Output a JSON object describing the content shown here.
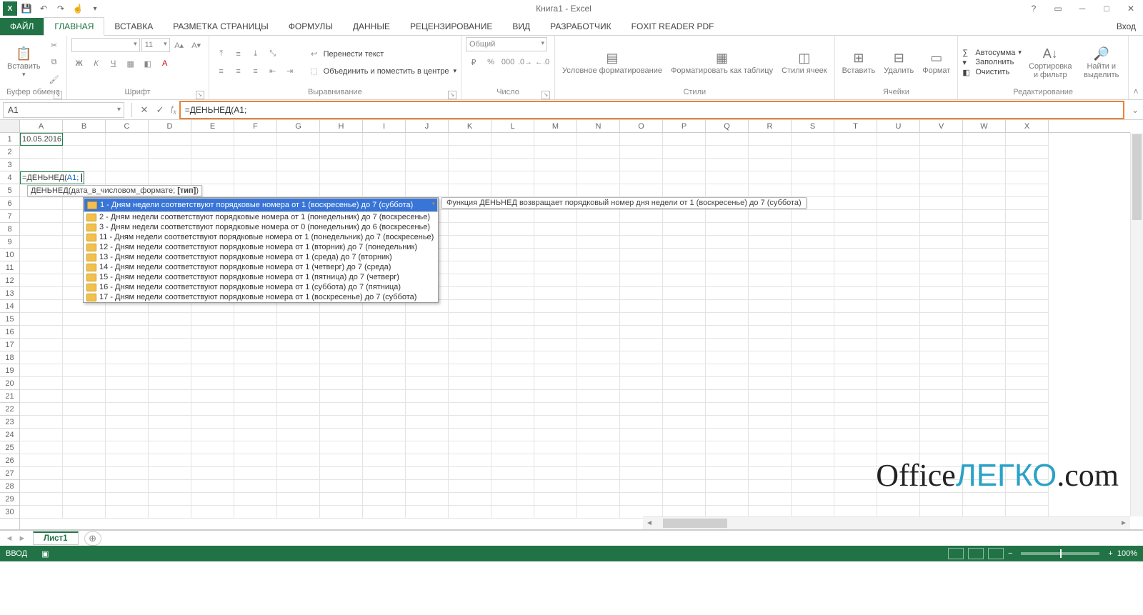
{
  "title": "Книга1 - Excel",
  "qat_icons": [
    "save",
    "undo",
    "redo",
    "touch",
    "dropdown"
  ],
  "login": "Вход",
  "help_icon": "?",
  "win": {
    "min": "─",
    "max": "□",
    "close": "✕",
    "ribmin": "▭"
  },
  "tabs": {
    "file": "ФАЙЛ",
    "items": [
      "ГЛАВНАЯ",
      "ВСТАВКА",
      "РАЗМЕТКА СТРАНИЦЫ",
      "ФОРМУЛЫ",
      "ДАННЫЕ",
      "РЕЦЕНЗИРОВАНИЕ",
      "ВИД",
      "РАЗРАБОТЧИК",
      "FOXIT READER PDF"
    ],
    "active": 0
  },
  "ribbon": {
    "clipboard": {
      "label": "Буфер обмена",
      "paste": "Вставить"
    },
    "font": {
      "label": "Шрифт",
      "name": "",
      "size": "11",
      "bold": "Ж",
      "italic": "К",
      "underline": "Ч"
    },
    "align": {
      "label": "Выравнивание",
      "wrap": "Перенести текст",
      "merge": "Объединить и поместить в центре"
    },
    "number": {
      "label": "Число",
      "format": "Общий"
    },
    "styles": {
      "label": "Стили",
      "cond": "Условное форматирование",
      "table": "Форматировать как таблицу",
      "cell": "Стили ячеек"
    },
    "cells": {
      "label": "Ячейки",
      "insert": "Вставить",
      "delete": "Удалить",
      "format": "Формат"
    },
    "editing": {
      "label": "Редактирование",
      "sum": "Автосумма",
      "fill": "Заполнить",
      "clear": "Очистить",
      "sort": "Сортировка и фильтр",
      "find": "Найти и выделить"
    }
  },
  "namebox": "A1",
  "formula": "=ДЕНЬНЕД(A1;",
  "columns": [
    "A",
    "B",
    "C",
    "D",
    "E",
    "F",
    "G",
    "H",
    "I",
    "J",
    "K",
    "L",
    "M",
    "N",
    "O",
    "P",
    "Q",
    "R",
    "S",
    "T",
    "U",
    "V",
    "W",
    "X"
  ],
  "rows": [
    "1",
    "2",
    "3",
    "4",
    "5",
    "6",
    "7",
    "8",
    "9",
    "10",
    "11",
    "12",
    "13",
    "14",
    "15",
    "16",
    "17",
    "18",
    "19",
    "20",
    "21",
    "22",
    "23",
    "24",
    "25",
    "26",
    "27",
    "28",
    "29",
    "30"
  ],
  "cellA1": "10.05.2016",
  "edit": {
    "prefix": "=ДЕНЬНЕД(",
    "ref": "A1",
    "suffix": ";"
  },
  "hint": {
    "fn": "ДЕНЬНЕД",
    "sig": "(дата_в_числовом_формате; ",
    "arg": "[тип]",
    "tail": ")"
  },
  "options": [
    "1 - Дням недели соответствуют порядковые номера от 1 (воскресенье) до 7 (суббота)",
    "2 - Дням недели соответствуют порядковые номера от 1 (понедельник) до 7 (воскресенье)",
    "3 - Дням недели соответствуют порядковые номера от 0 (понедельник) до 6 (воскресенье)",
    "11 - Дням недели соответствуют порядковые номера от 1 (понедельник) до 7 (воскресенье)",
    "12 - Дням недели соответствуют порядковые номера от 1 (вторник) до 7 (понедельник)",
    "13 - Дням недели соответствуют порядковые номера от 1 (среда) до 7 (вторник)",
    "14 - Дням недели соответствуют порядковые номера от 1 (четверг) до 7 (среда)",
    "15 - Дням недели соответствуют порядковые номера от 1 (пятница) до 7 (четверг)",
    "16 - Дням недели соответствуют порядковые номера от 1 (суббота) до 7 (пятница)",
    "17 - Дням недели соответствуют порядковые номера от 1 (воскресенье) до 7 (суббота)"
  ],
  "option_sel": 0,
  "description": "Функция ДЕНЬНЕД возвращает порядковый номер дня недели от 1 (воскресенье) до 7 (суббота)",
  "sheet": "Лист1",
  "status": "ВВОД",
  "zoom": "100%",
  "watermark": {
    "a": "Office",
    "b": "ЛЕГКО",
    "c": ".com"
  }
}
